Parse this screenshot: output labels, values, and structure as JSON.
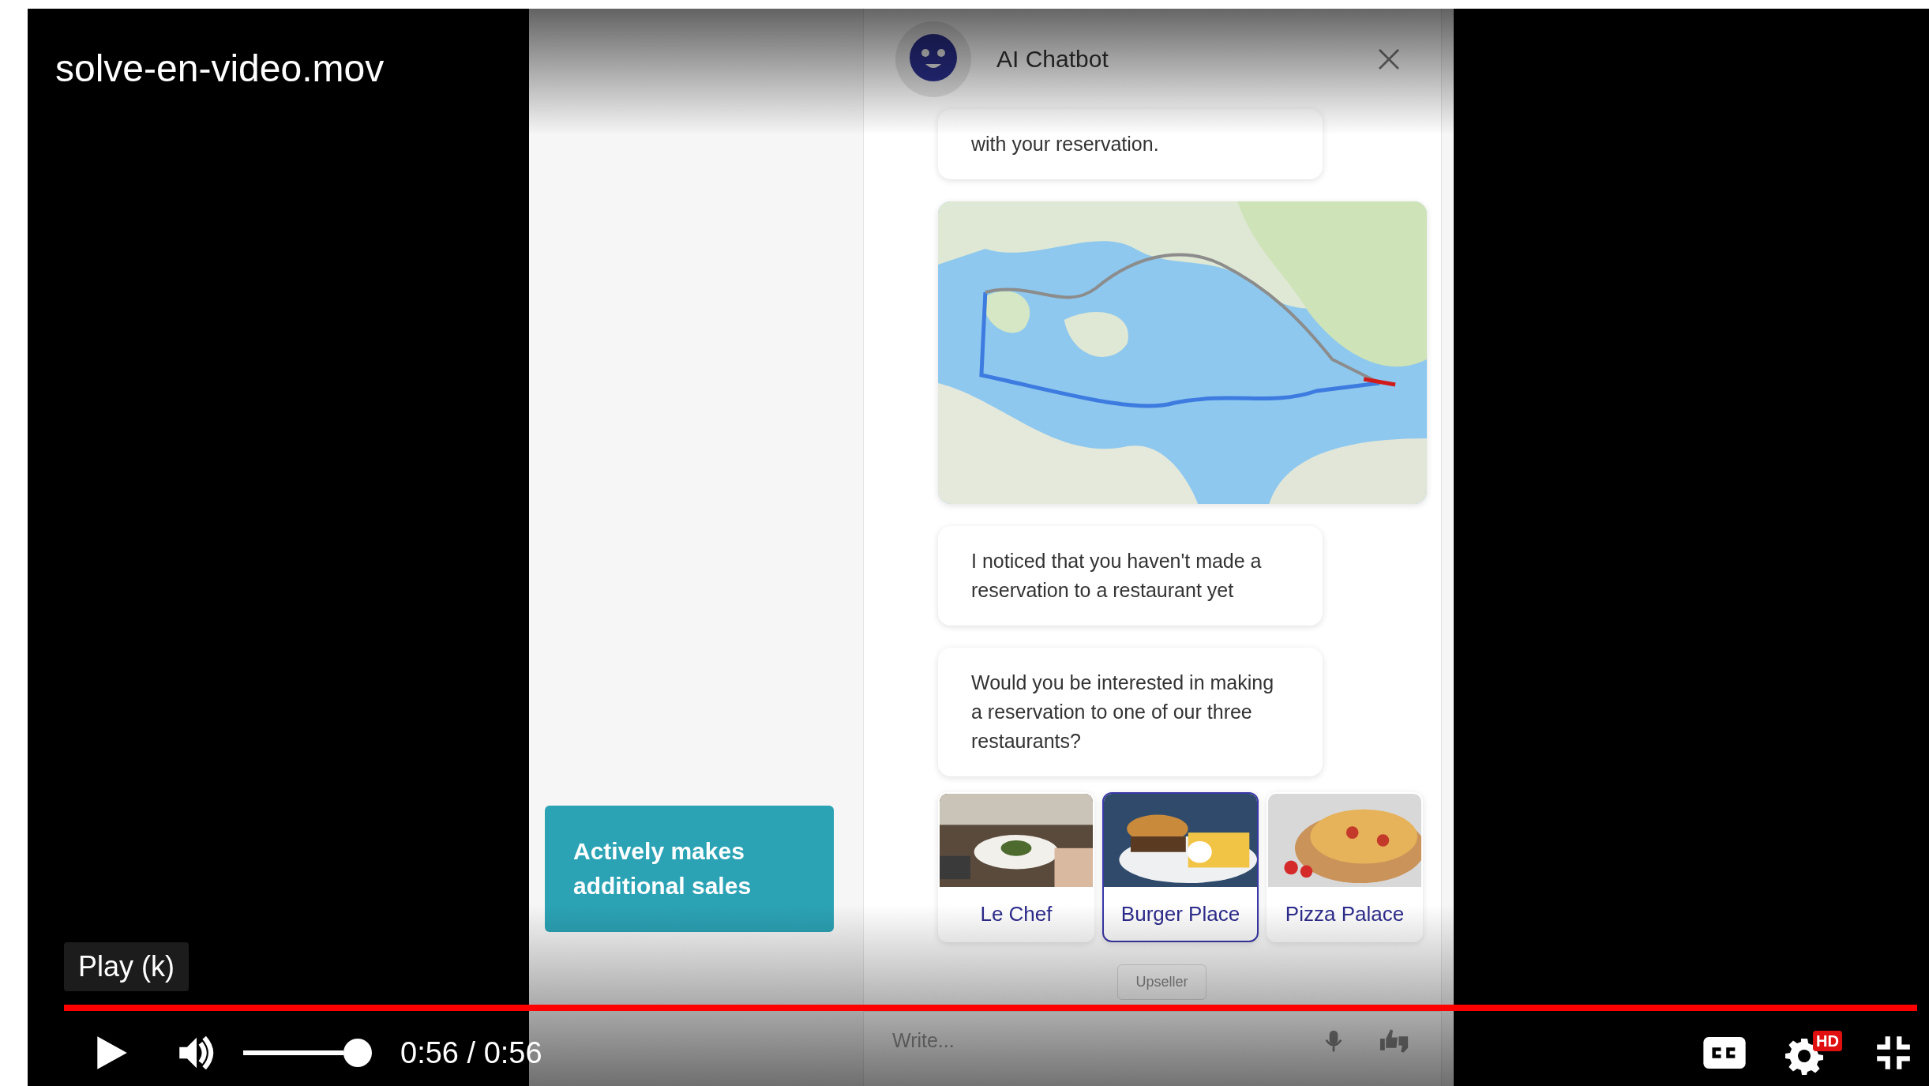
{
  "video": {
    "title": "solve-en-video.mov"
  },
  "chat": {
    "title": "AI Chatbot",
    "messages": [
      {
        "kind": "text",
        "text": "with your reservation."
      },
      {
        "kind": "map"
      },
      {
        "kind": "text",
        "text": "I noticed that you haven't made a reservation to a restaurant yet"
      },
      {
        "kind": "text",
        "text": "Would you be interested in making a reservation to one of our three restaurants?"
      }
    ],
    "options": [
      {
        "label": "Le Chef",
        "selected": false
      },
      {
        "label": "Burger Place",
        "selected": true
      },
      {
        "label": "Pizza Palace",
        "selected": false
      }
    ],
    "tag": "Upseller",
    "input": {
      "placeholder": "Write..."
    }
  },
  "callout": "Actively makes additional sales",
  "tooltip": "Play (k)",
  "player": {
    "progress": {
      "level": 1
    },
    "volume": {
      "level": 1
    },
    "time": "0:56 / 0:56",
    "hd_badge": "HD"
  }
}
